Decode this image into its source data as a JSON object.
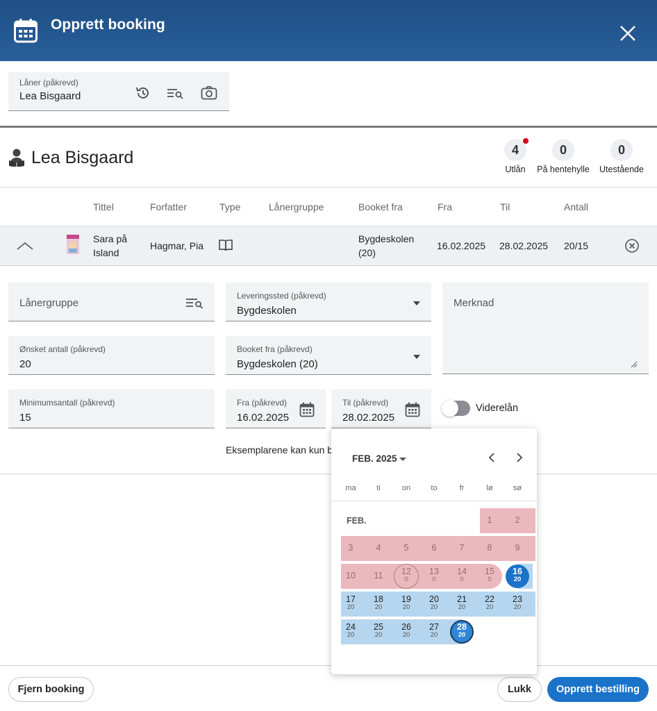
{
  "header": {
    "title": "Opprett booking",
    "icon": "calendar-icon",
    "close_icon": "close-icon",
    "bg_color": "#245a91"
  },
  "loaner_field": {
    "label": "Låner (påkrevd)",
    "value": "Lea Bisgaard"
  },
  "patron": {
    "name": "Lea Bisgaard",
    "stats": [
      {
        "value": "4",
        "label": "Utlån",
        "alert": true
      },
      {
        "value": "0",
        "label": "På hentehylle",
        "alert": false
      },
      {
        "value": "0",
        "label": "Utestående",
        "alert": false
      }
    ]
  },
  "table": {
    "headers": {
      "tittel": "Tittel",
      "forfatter": "Forfatter",
      "type": "Type",
      "lanergruppe": "Lånergruppe",
      "booket_fra": "Booket fra",
      "fra": "Fra",
      "til": "Til",
      "antall": "Antall"
    },
    "row": {
      "title_line1": "Sara på",
      "title_line2": "Island",
      "author": "Hagmar, Pia",
      "type_icon": "book-icon",
      "booked_from_line1": "Bygdeskolen",
      "booked_from_line2": "(20)",
      "from": "16.02.2025",
      "to": "28.02.2025",
      "amount": "20/15"
    }
  },
  "form": {
    "lanergruppe": {
      "label": "Lånergruppe"
    },
    "leveringssted": {
      "label": "Leveringssted (påkrevd)",
      "value": "Bygdeskolen"
    },
    "merknad": {
      "label": "Merknad"
    },
    "onsket_antall": {
      "label": "Ønsket antall (påkrevd)",
      "value": "20"
    },
    "booket_fra": {
      "label": "Booket fra (påkrevd)",
      "value": "Bygdeskolen (20)"
    },
    "minimumsantall": {
      "label": "Minimumsantall (påkrevd)",
      "value": "15"
    },
    "fra": {
      "label": "Fra (påkrevd)",
      "value": "16.02.2025"
    },
    "til": {
      "label": "Til (påkrevd)",
      "value": "28.02.2025"
    },
    "viderelan": {
      "label": "Viderelån",
      "on": false
    },
    "info_text": "Eksemplarene kan kun b"
  },
  "picker": {
    "month_label": "FEB. 2025",
    "month_short": "FEB.",
    "weekdays": [
      "ma",
      "ti",
      "on",
      "to",
      "fr",
      "lø",
      "sø"
    ],
    "days": [
      {
        "d": "1",
        "c": ""
      },
      {
        "d": "2",
        "c": ""
      },
      {
        "d": "3",
        "c": ""
      },
      {
        "d": "4",
        "c": ""
      },
      {
        "d": "5",
        "c": ""
      },
      {
        "d": "6",
        "c": ""
      },
      {
        "d": "7",
        "c": ""
      },
      {
        "d": "8",
        "c": ""
      },
      {
        "d": "9",
        "c": ""
      },
      {
        "d": "10",
        "c": ""
      },
      {
        "d": "11",
        "c": ""
      },
      {
        "d": "12",
        "c": "0"
      },
      {
        "d": "13",
        "c": "0"
      },
      {
        "d": "14",
        "c": "0"
      },
      {
        "d": "15",
        "c": "0"
      },
      {
        "d": "16",
        "c": "20"
      },
      {
        "d": "17",
        "c": "20"
      },
      {
        "d": "18",
        "c": "20"
      },
      {
        "d": "19",
        "c": "20"
      },
      {
        "d": "20",
        "c": "20"
      },
      {
        "d": "21",
        "c": "20"
      },
      {
        "d": "22",
        "c": "20"
      },
      {
        "d": "23",
        "c": "20"
      },
      {
        "d": "24",
        "c": "20"
      },
      {
        "d": "25",
        "c": "20"
      },
      {
        "d": "26",
        "c": "20"
      },
      {
        "d": "27",
        "c": "20"
      },
      {
        "d": "28",
        "c": "20"
      }
    ],
    "unavailable_color": "#ebb8be",
    "available_color": "#b6d6ef",
    "selected_color": "#1a73c9"
  },
  "footer": {
    "remove_label": "Fjern booking",
    "close_label": "Lukk",
    "create_label": "Opprett bestilling"
  }
}
